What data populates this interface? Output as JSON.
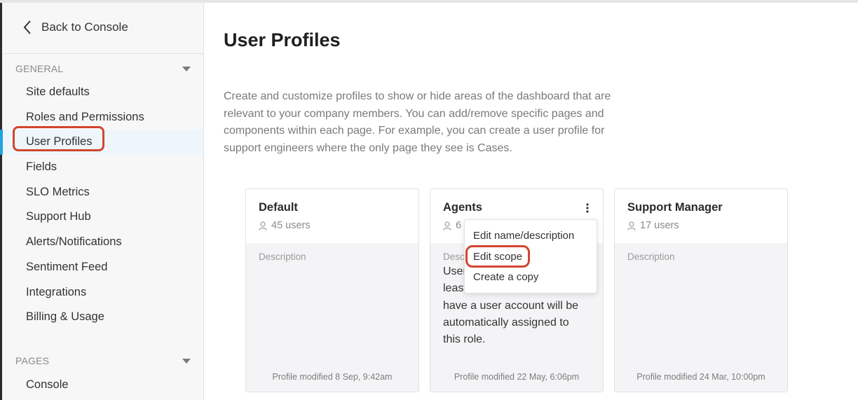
{
  "sidebar": {
    "back_label": "Back to Console",
    "general_heading": "GENERAL",
    "items": [
      {
        "label": "Site defaults"
      },
      {
        "label": "Roles and Permissions"
      },
      {
        "label": "User Profiles"
      },
      {
        "label": "Fields"
      },
      {
        "label": "SLO Metrics"
      },
      {
        "label": "Support Hub"
      },
      {
        "label": "Alerts/Notifications"
      },
      {
        "label": "Sentiment Feed"
      },
      {
        "label": "Integrations"
      },
      {
        "label": "Billing & Usage"
      }
    ],
    "pages_heading": "PAGES",
    "pages_items": [
      {
        "label": "Console"
      }
    ]
  },
  "main": {
    "title": "User Profiles",
    "intro": "Create and customize profiles to show or hide areas of the dashboard that are relevant to your company members. You can add/remove specific pages and components within each page. For example, you can create a user profile for support engineers where the only page they see is Cases."
  },
  "cards": [
    {
      "name": "Default",
      "users": "45 users",
      "desc_label": "Description",
      "desc_text": "",
      "modified": "Profile modified 8 Sep, 9:42am"
    },
    {
      "name": "Agents",
      "users": "6",
      "desc_label": "Desc",
      "desc_text": "User ... least ... have a user account will be automatically assigned to this role.",
      "desc_lines": [
        "User",
        "least",
        "have a user account will be",
        "automatically assigned to",
        "this role."
      ],
      "modified": "Profile modified 22 May, 6:06pm"
    },
    {
      "name": "Support Manager",
      "users": "17 users",
      "desc_label": "Description",
      "desc_text": "",
      "modified": "Profile modified 24 Mar, 10:00pm"
    }
  ],
  "context_menu": {
    "items": [
      "Edit name/description",
      "Edit scope",
      "Create a copy"
    ]
  },
  "colors": {
    "accent": "#1fa4e0",
    "highlight": "#d2452f"
  }
}
